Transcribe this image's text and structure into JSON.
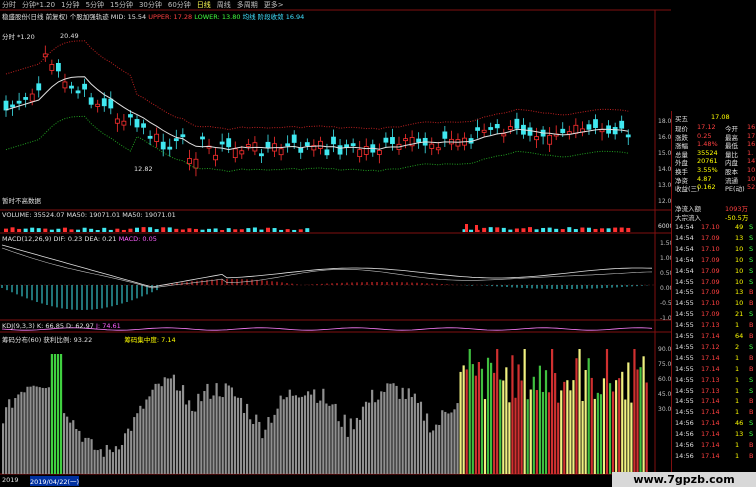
{
  "toolbar": {
    "periods": [
      "分时",
      "分钟*1.20",
      "1分钟",
      "5分钟",
      "15分钟",
      "30分钟",
      "60分钟",
      "日线",
      "周线",
      "多周期",
      "更多>"
    ],
    "selected_index": 7
  },
  "main_chart": {
    "title": "稳盛股份(日线 前复权) 个股加强轨迹",
    "mid_label": "MID: 15.54",
    "upper_label": "UPPER: 17.28",
    "lower_label": "LOWER: 13.80",
    "extra_label": "均线 阶段收敛 16.94",
    "second_line": "分时 *1.20",
    "peak_label": "20.49",
    "low_label": "12.82",
    "foot_label": "暂时不高数据",
    "y_ticks": [
      "18.00",
      "16.00",
      "15.00",
      "14.00",
      "13.00",
      "12.00"
    ]
  },
  "volume_panel": {
    "label": "VOLUME: 35524.07  MA50: 19071.01  MA50: 19071.01",
    "right_tick": "60000"
  },
  "macd_panel": {
    "label": "MACD(12,26,9)  DIF: 0.23  DEA: 0.21",
    "macd_value": "MACD: 0.05",
    "y_ticks": [
      "1.50",
      "1.00",
      "0.50",
      "0.00",
      "-0.50",
      "-1.00"
    ]
  },
  "kdj_panel": {
    "label": "KDJ(9,3,3)  K: 66.85  D: 62.97",
    "j_value": "J: 74.61"
  },
  "bottom_panel": {
    "label": "筹码分布(60)  获利比例: 93.22",
    "conc_label": "筹码集中度: 7.14",
    "y_ticks": [
      "90.00",
      "75.00",
      "60.00",
      "45.00",
      "30.00"
    ]
  },
  "bottom_bar": {
    "left_text": "2019",
    "date_text": "2019/04/22(一)"
  },
  "quote_panel": {
    "header": {
      "label": "买五",
      "value": "17.08"
    },
    "rows": [
      {
        "a": "现价",
        "b": "17.12",
        "c": "今开",
        "d": "16."
      },
      {
        "a": "涨跌",
        "b": "0.25",
        "c": "最高",
        "d": "17."
      },
      {
        "a": "涨幅",
        "b": "1.48%",
        "c": "最低",
        "d": "16."
      },
      {
        "a": "总量",
        "b": "35524",
        "c": "量比",
        "d": "1."
      },
      {
        "a": "外盘",
        "b": "20761",
        "c": "内盘",
        "d": "147"
      },
      {
        "a": "换手",
        "b": "3.55%",
        "c": "股本",
        "d": "10."
      },
      {
        "a": "净资",
        "b": "4.87",
        "c": "流通",
        "d": "10."
      },
      {
        "a": "收益(三)",
        "b": "0.162",
        "c": "PE(动)",
        "d": "52."
      }
    ],
    "net_inflow": {
      "label": "净流入额",
      "value": "1093万"
    },
    "big_order": {
      "label": "大宗流入",
      "value": "-50.5万"
    },
    "ticks": [
      {
        "t": "14:54",
        "p": "17.10",
        "v": "49",
        "s": "S"
      },
      {
        "t": "14:54",
        "p": "17.09",
        "v": "13",
        "s": "S"
      },
      {
        "t": "14:54",
        "p": "17.10",
        "v": "10",
        "s": "S"
      },
      {
        "t": "14:54",
        "p": "17.09",
        "v": "10",
        "s": "S"
      },
      {
        "t": "14:54",
        "p": "17.09",
        "v": "10",
        "s": "S"
      },
      {
        "t": "14:55",
        "p": "17.09",
        "v": "10",
        "s": "S"
      },
      {
        "t": "14:55",
        "p": "17.09",
        "v": "13",
        "s": "B"
      },
      {
        "t": "14:55",
        "p": "17.10",
        "v": "10",
        "s": "B"
      },
      {
        "t": "14:55",
        "p": "17.09",
        "v": "21",
        "s": "S"
      },
      {
        "t": "14:55",
        "p": "17.13",
        "v": "1",
        "s": "B"
      },
      {
        "t": "14:55",
        "p": "17.14",
        "v": "64",
        "s": "B"
      },
      {
        "t": "14:55",
        "p": "17.12",
        "v": "2",
        "s": "S"
      },
      {
        "t": "14:55",
        "p": "17.14",
        "v": "1",
        "s": "B"
      },
      {
        "t": "14:55",
        "p": "17.14",
        "v": "1",
        "s": "B"
      },
      {
        "t": "14:55",
        "p": "17.13",
        "v": "1",
        "s": "S"
      },
      {
        "t": "14:55",
        "p": "17.13",
        "v": "1",
        "s": "S"
      },
      {
        "t": "14:55",
        "p": "17.14",
        "v": "1",
        "s": "B"
      },
      {
        "t": "14:55",
        "p": "17.14",
        "v": "1",
        "s": "B"
      },
      {
        "t": "14:56",
        "p": "17.14",
        "v": "46",
        "s": "S"
      },
      {
        "t": "14:56",
        "p": "17.14",
        "v": "13",
        "s": "S"
      },
      {
        "t": "14:56",
        "p": "17.14",
        "v": "1",
        "s": "B"
      },
      {
        "t": "14:56",
        "p": "17.14",
        "v": "1",
        "s": "B"
      }
    ]
  },
  "watermark": "www.7gpzb.com",
  "colors": {
    "up": "#ff3030",
    "down": "#40e8f0",
    "grid": "#801010",
    "mid": "#e0e0e0",
    "upper": "#c02020",
    "lower": "#20a020"
  }
}
